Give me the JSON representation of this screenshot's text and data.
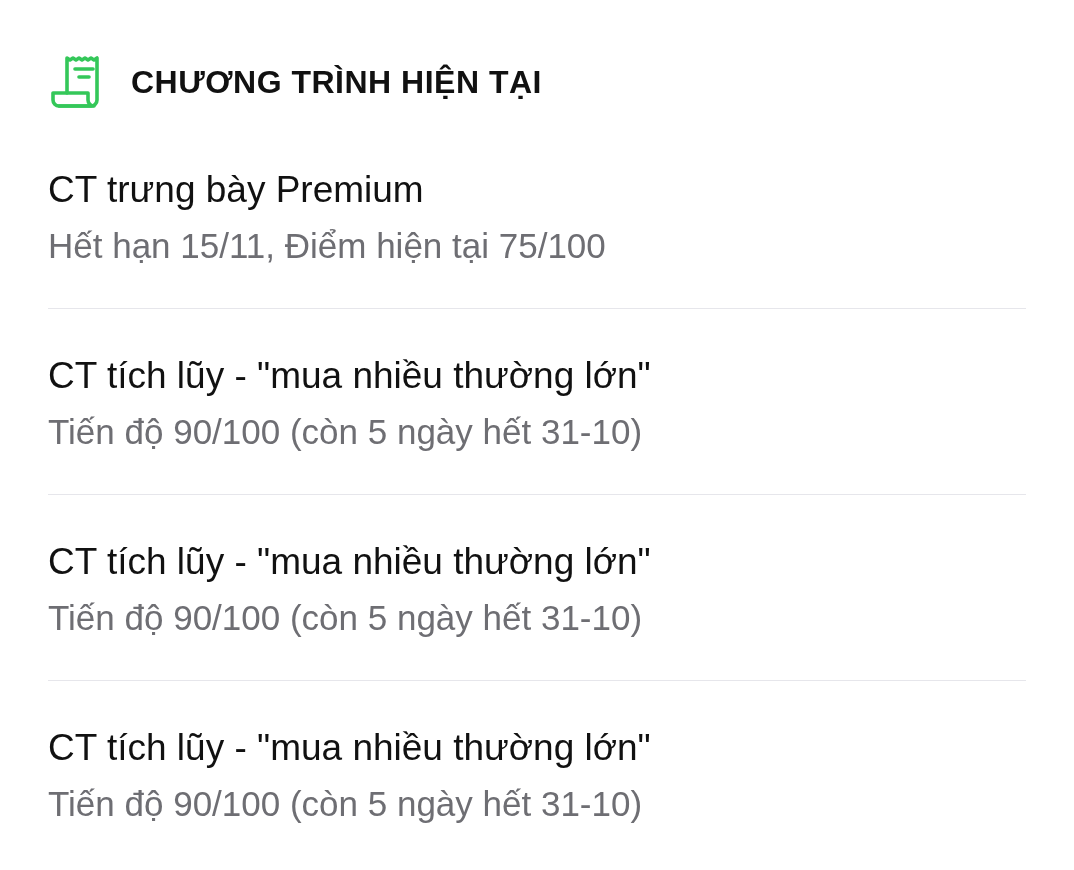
{
  "header": {
    "title": "CHƯƠNG TRÌNH HIỆN TẠI"
  },
  "programs": [
    {
      "title": "CT trưng bày Premium",
      "detail": "Hết hạn 15/11, Điểm hiện tại 75/100"
    },
    {
      "title": "CT tích lũy - \"mua nhiều thường lớn\"",
      "detail": "Tiến độ 90/100 (còn 5 ngày hết 31-10)"
    },
    {
      "title": "CT tích lũy - \"mua nhiều thường lớn\"",
      "detail": "Tiến độ 90/100 (còn 5 ngày hết 31-10)"
    },
    {
      "title": "CT tích lũy - \"mua nhiều thường lớn\"",
      "detail": "Tiến độ 90/100 (còn 5 ngày hết 31-10)"
    }
  ]
}
